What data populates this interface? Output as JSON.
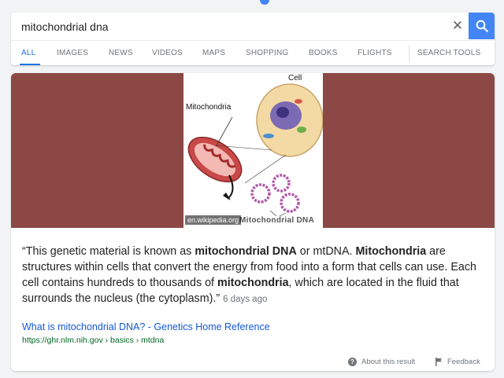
{
  "search": {
    "query": "mitochondrial dna"
  },
  "tabs": [
    {
      "label": "ALL"
    },
    {
      "label": "IMAGES"
    },
    {
      "label": "NEWS"
    },
    {
      "label": "VIDEOS"
    },
    {
      "label": "MAPS"
    },
    {
      "label": "SHOPPING"
    },
    {
      "label": "BOOKS"
    },
    {
      "label": "FLIGHTS"
    },
    {
      "label": "SEARCH TOOLS"
    }
  ],
  "hero": {
    "source": "en.wikipedia.org",
    "label_cell": "Cell",
    "label_mitochondria": "Mitochondria",
    "caption": "Mitochondrial DNA"
  },
  "snippet": {
    "p1": "“This genetic material is known as ",
    "b1": "mitochondrial DNA",
    "p2": " or mtDNA. ",
    "b2": "Mitochondria",
    "p3": " are structures within cells that convert the energy from food into a form that cells can use. Each cell contains hundreds to thousands of ",
    "b3": "mitochondria",
    "p4": ", which are located in the fluid that surrounds the nucleus (the cytoplasm).”",
    "date": "6 days ago"
  },
  "result": {
    "title": "What is mitochondrial DNA? - Genetics Home Reference",
    "url": "https://ghr.nlm.nih.gov › basics › mtdna"
  },
  "footer": {
    "about": "About this result",
    "feedback": "Feedback"
  },
  "colors": {
    "accent": "#4285f4",
    "hero_bg": "#8b4845",
    "link": "#1558d6",
    "url": "#006621"
  }
}
